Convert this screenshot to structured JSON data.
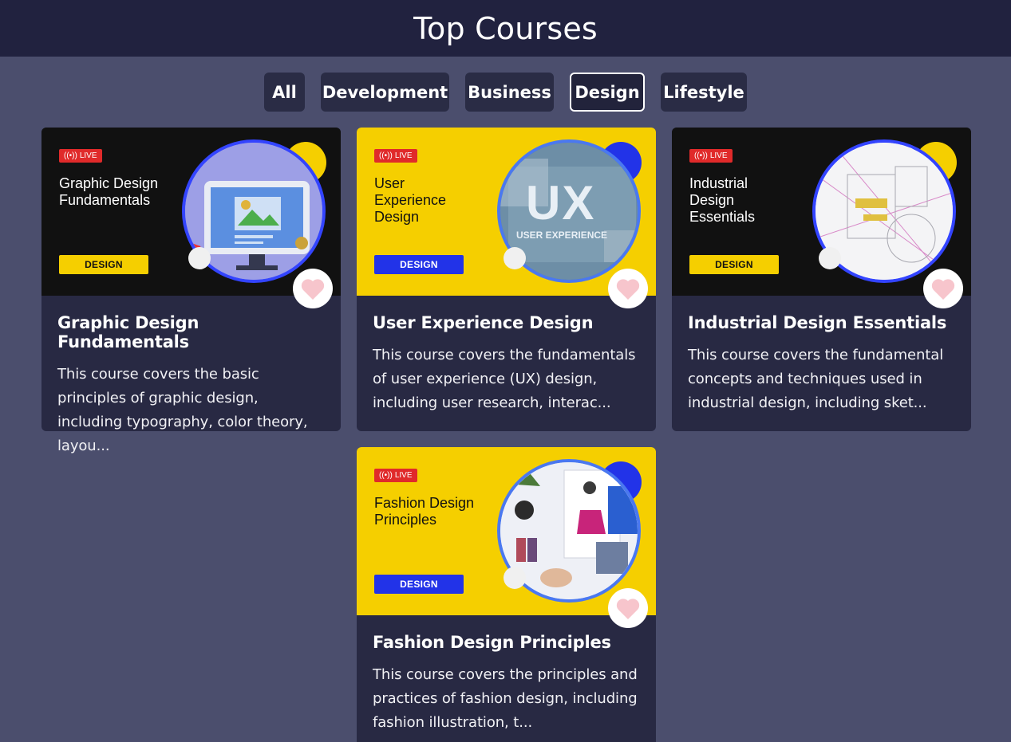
{
  "header": {
    "title": "Top Courses"
  },
  "filters": [
    {
      "label": "All",
      "active": false
    },
    {
      "label": "Development",
      "active": false
    },
    {
      "label": "Business",
      "active": false
    },
    {
      "label": "Design",
      "active": true
    },
    {
      "label": "Lifestyle",
      "active": false
    }
  ],
  "colors": {
    "page_bg": "#4b4e6d",
    "topbar_bg": "#21223f",
    "card_bg": "#282943",
    "accent_yellow": "#f5cf00",
    "accent_blue": "#2233e8",
    "live_red": "#e02a2a",
    "heart_pink": "#f7c5cc"
  },
  "courses": [
    {
      "thumb_live": "LIVE",
      "thumb_title": "Graphic Design Fundamentals",
      "thumb_tag": "DESIGN",
      "title": "Graphic Design Fundamentals",
      "description": "This course covers the basic principles of graphic design, including typography, color theory, layou...",
      "icon": "heart-icon"
    },
    {
      "thumb_live": "LIVE",
      "thumb_title": "User Experience Design",
      "thumb_tag": "DESIGN",
      "title": "User Experience Design",
      "description": "This course covers the fundamentals of user experience (UX) design, including user research, interac...",
      "thumb_image_text": "UX",
      "thumb_image_subtext": "USER EXPERIENCE",
      "icon": "heart-icon"
    },
    {
      "thumb_live": "LIVE",
      "thumb_title": "Industrial Design Essentials",
      "thumb_tag": "DESIGN",
      "title": "Industrial Design Essentials",
      "description": "This course covers the fundamental concepts and techniques used in industrial design, including sket...",
      "icon": "heart-icon"
    },
    {
      "thumb_live": "LIVE",
      "thumb_title": "Fashion Design Principles",
      "thumb_tag": "DESIGN",
      "title": "Fashion Design Principles",
      "description": "This course covers the principles and practices of fashion design, including fashion illustration, t...",
      "icon": "heart-icon"
    }
  ]
}
